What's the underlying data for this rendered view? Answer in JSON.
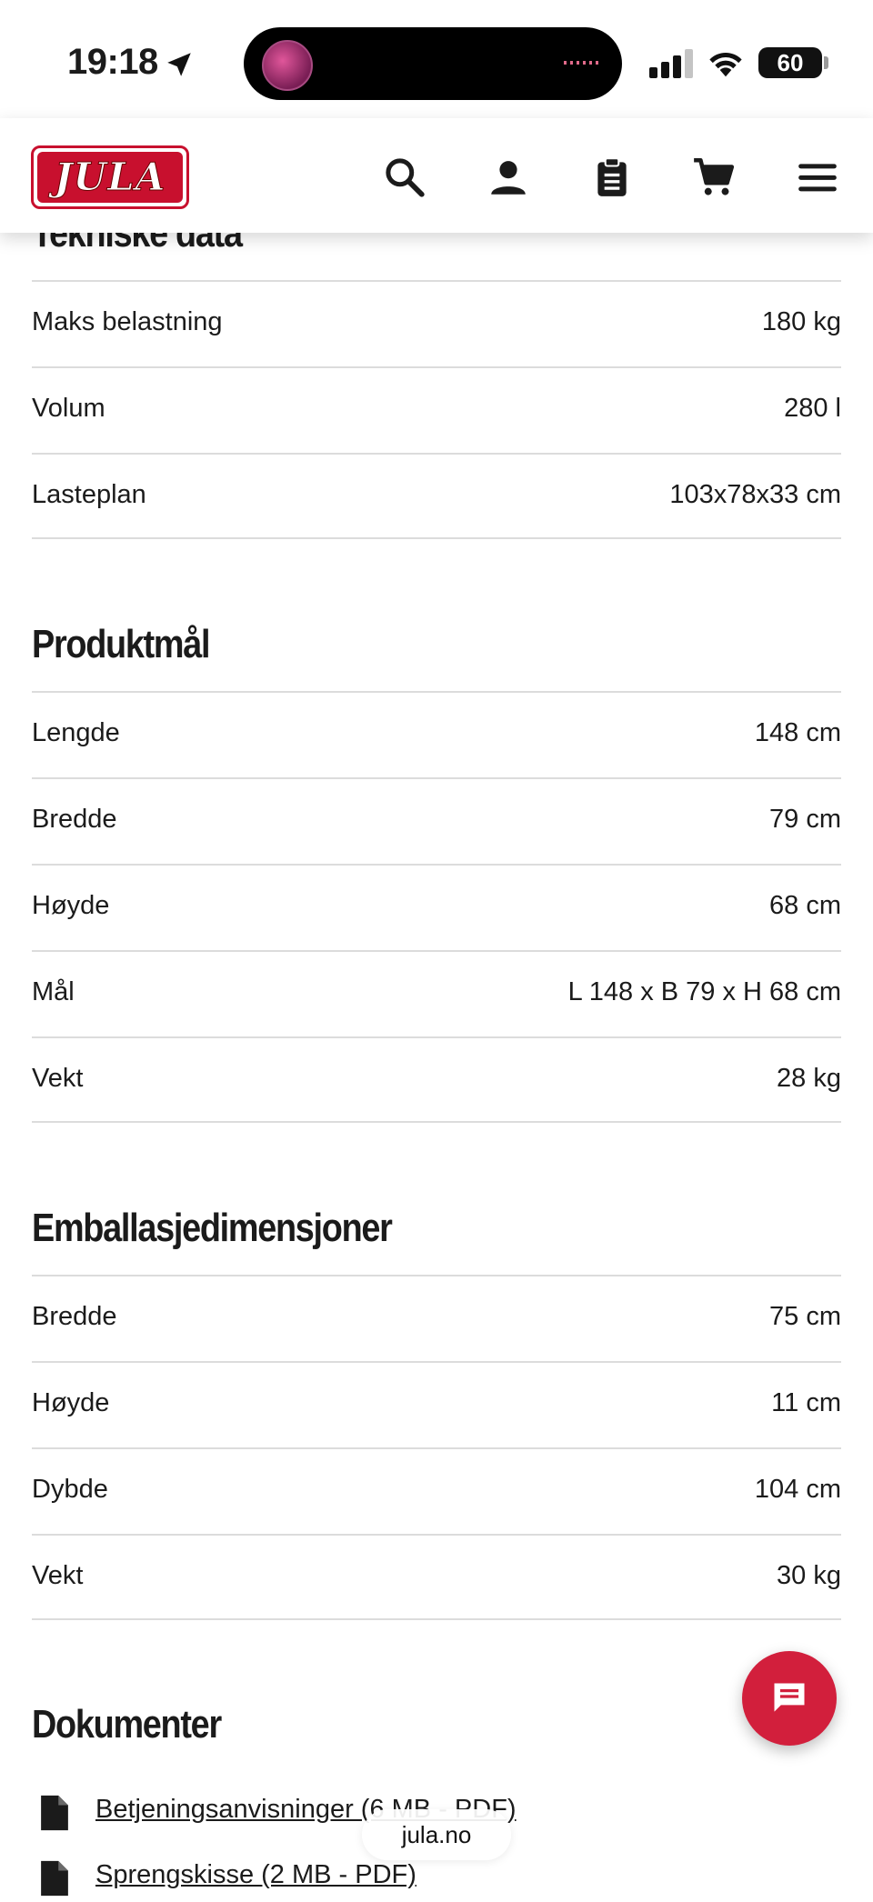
{
  "status_bar": {
    "time": "19:18",
    "battery": "60",
    "island_app": "location-arrow-icon"
  },
  "header": {
    "logo_text": "JULA",
    "icons": [
      "search-icon",
      "user-icon",
      "clipboard-icon",
      "cart-icon",
      "menu-icon"
    ],
    "brand_color": "#c8102e"
  },
  "sections": [
    {
      "title": "Tekniske data",
      "rows": [
        {
          "label": "Maks belastning",
          "value": "180 kg"
        },
        {
          "label": "Volum",
          "value": "280 l"
        },
        {
          "label": "Lasteplan",
          "value": "103x78x33 cm"
        }
      ]
    },
    {
      "title": "Produktmål",
      "rows": [
        {
          "label": "Lengde",
          "value": "148 cm"
        },
        {
          "label": "Bredde",
          "value": "79 cm"
        },
        {
          "label": "Høyde",
          "value": "68 cm"
        },
        {
          "label": "Mål",
          "value": "L 148 x B 79 x H 68 cm"
        },
        {
          "label": "Vekt",
          "value": "28 kg"
        }
      ]
    },
    {
      "title": "Emballasjedimensjoner",
      "rows": [
        {
          "label": "Bredde",
          "value": "75 cm"
        },
        {
          "label": "Høyde",
          "value": "11 cm"
        },
        {
          "label": "Dybde",
          "value": "104 cm"
        },
        {
          "label": "Vekt",
          "value": "30 kg"
        }
      ]
    }
  ],
  "documents": {
    "title": "Dokumenter",
    "links": [
      {
        "label": "Betjeningsanvisninger (6 MB - PDF)"
      },
      {
        "label": "Sprengskisse (2 MB - PDF)"
      }
    ]
  },
  "browser": {
    "url": "jula.no"
  },
  "chat": {
    "icon": "chat-icon",
    "color": "#d21f3c"
  }
}
